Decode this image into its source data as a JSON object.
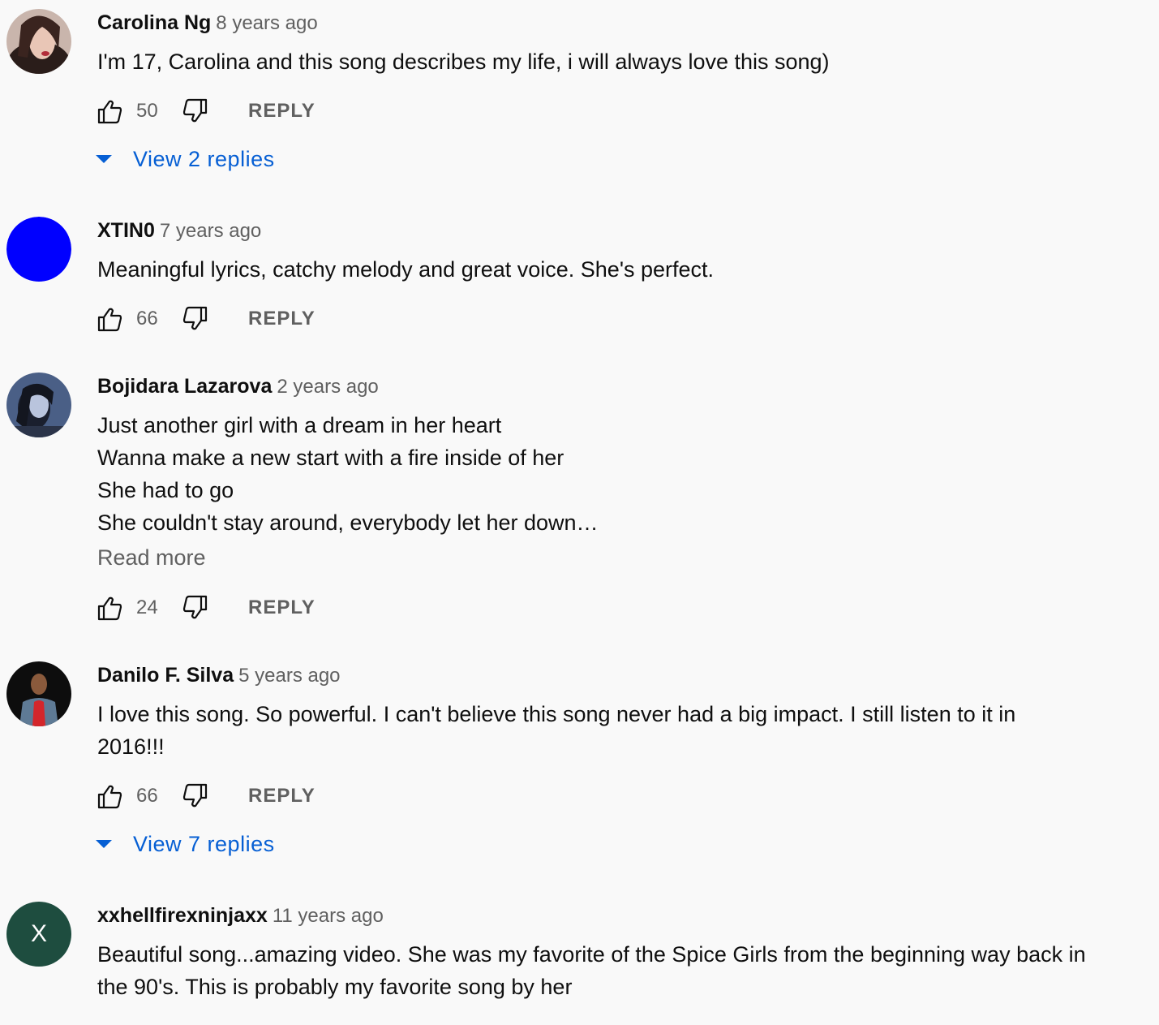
{
  "reply_label": "REPLY",
  "comments": [
    {
      "author": "Carolina Ng",
      "time": "8 years ago",
      "lines": [
        "I'm 17, Carolina and this song describes my life, i will always love this song)"
      ],
      "likes": "50",
      "replies_label": "View 2 replies"
    },
    {
      "author": "XTIN0",
      "time": "7 years ago",
      "lines": [
        "Meaningful lyrics, catchy melody and great voice. She's perfect."
      ],
      "likes": "66",
      "avatar_color": "#0000ff"
    },
    {
      "author": "Bojidara Lazarova",
      "time": "2 years ago",
      "lines": [
        "Just another girl with a dream in her heart",
        "Wanna make a new start with a fire inside of her",
        "She had to go",
        "She couldn't stay around, everybody let her down…"
      ],
      "read_more": "Read more",
      "likes": "24"
    },
    {
      "author": "Danilo F. Silva",
      "time": "5 years ago",
      "lines": [
        "I love this song. So powerful. I can't believe this song never had a big impact. I still listen to it in",
        "2016!!!"
      ],
      "likes": "66",
      "replies_label": "View 7 replies"
    },
    {
      "author": "xxhellfirexninjaxx",
      "time": "11 years ago",
      "lines": [
        "Beautiful song...amazing video. She was my favorite of the Spice Girls from the beginning way back in",
        "the 90's. This is probably my favorite song by her"
      ],
      "avatar_letter": "X",
      "avatar_color": "#1e4d3f"
    }
  ],
  "colors": {
    "background": "#f9f9f9",
    "link_blue": "#065fd4",
    "secondary_text": "#606060"
  }
}
